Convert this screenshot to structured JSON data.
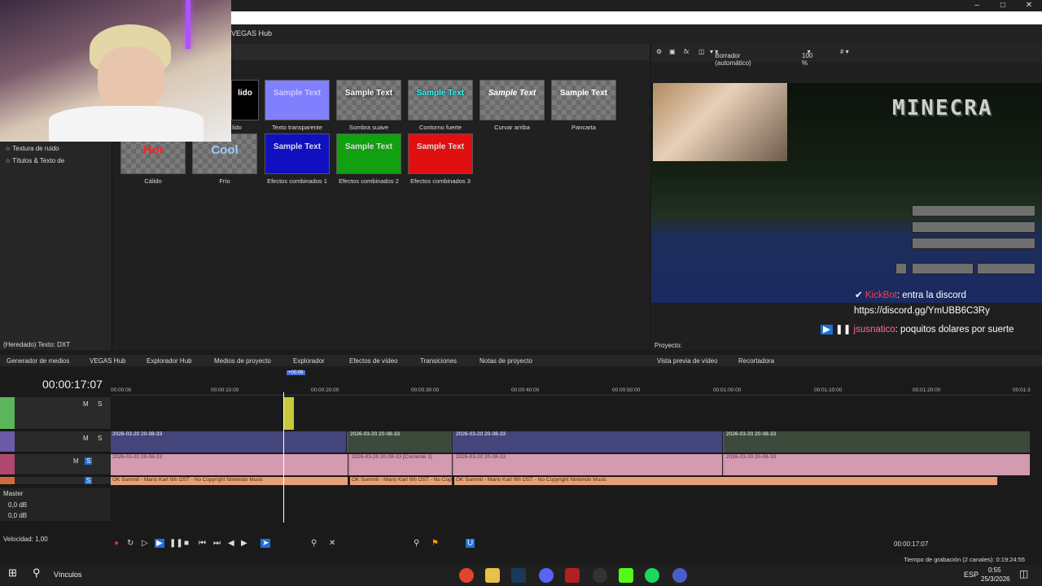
{
  "window": {
    "hub_label": "VEGAS Hub",
    "min": "–",
    "max": "□",
    "close": "✕"
  },
  "left_panel": {
    "tree_items": [
      "Textura de ruido",
      "Títulos & Texto de"
    ],
    "status": "(Heredado) Texto: DXT"
  },
  "presets": [
    {
      "sample": "lido",
      "caption": "lido",
      "style": "solid"
    },
    {
      "sample": "Sample Text",
      "caption": "Texto transparente",
      "style": "transparent"
    },
    {
      "sample": "Sample Text",
      "caption": "Sombra suave",
      "style": "soft"
    },
    {
      "sample": "Sample Text",
      "caption": "Contorno fuerte",
      "style": "outline"
    },
    {
      "sample": "Sample Text",
      "caption": "Curvar arriba",
      "style": "curve"
    },
    {
      "sample": "Sample Text",
      "caption": "Pancarta",
      "style": "banner"
    },
    {
      "sample": "Hot",
      "caption": "Cálido",
      "style": "hot"
    },
    {
      "sample": "Cool",
      "caption": "Frío",
      "style": "cool"
    },
    {
      "sample": "Sample Text",
      "caption": "Efectos combinados 1",
      "style": "blue"
    },
    {
      "sample": "Sample Text",
      "caption": "Efectos combinados 2",
      "style": "green"
    },
    {
      "sample": "Sample Text",
      "caption": "Efectos combinados 3",
      "style": "red"
    }
  ],
  "preview": {
    "mode": "Borrador (automático)",
    "zoom": "100 %",
    "game_logo": "MINECRA",
    "menu_buttons": [
      "",
      "",
      "",
      "",
      ""
    ],
    "chat": [
      {
        "name": "KickBot",
        "text": ": entra la discord"
      },
      {
        "name": "",
        "text": "https://discord.gg/YmUBB6C3Ry"
      },
      {
        "name": "jsusnatico",
        "text": ": poquitos dolares por suerte"
      }
    ],
    "project_label": "Proyecto:"
  },
  "tabs": [
    "Generador de medios",
    "VEGAS Hub",
    "Explorador Hub",
    "Medios de proyecto",
    "Explorador",
    "Efectos de vídeo",
    "Transiciones",
    "Notas de proyecto",
    "Vista previa de vídeo",
    "Recortadora"
  ],
  "timeline": {
    "timecode": "00:00:17:07",
    "ruler_ticks": [
      "00:00:00",
      "00:00:10:00",
      "00:00:20:00",
      "00:00:30:00",
      "00:00:40:00",
      "00:00:50:00",
      "00:01:00:00",
      "00:01:10:00",
      "00:01:20:00",
      "00:01:3"
    ],
    "playhead_marker": "+00:08",
    "clip_label": "2026-03-20 20-08-33",
    "audio_clip_label": "2026-03-20 20-08-33 [Corriente 1]",
    "music_label": "OK Summit - Mario Kart Wii OST - No Copyright Nintendo Music",
    "master_label": "Master",
    "master_db_1": "0,0 dB",
    "master_db_2": "0,0 dB",
    "speed_label": "Velocidad: 1,00",
    "track_ms": "M",
    "track_s": "S",
    "end_timecode": "00:00:17:07",
    "record_time": "Tiempo de grabación (2 canales): 0:19:24:55"
  },
  "taskbar": {
    "search_label": "Vínculos",
    "lang": "ESP",
    "time": "0:55",
    "date": "25/3/2026"
  }
}
